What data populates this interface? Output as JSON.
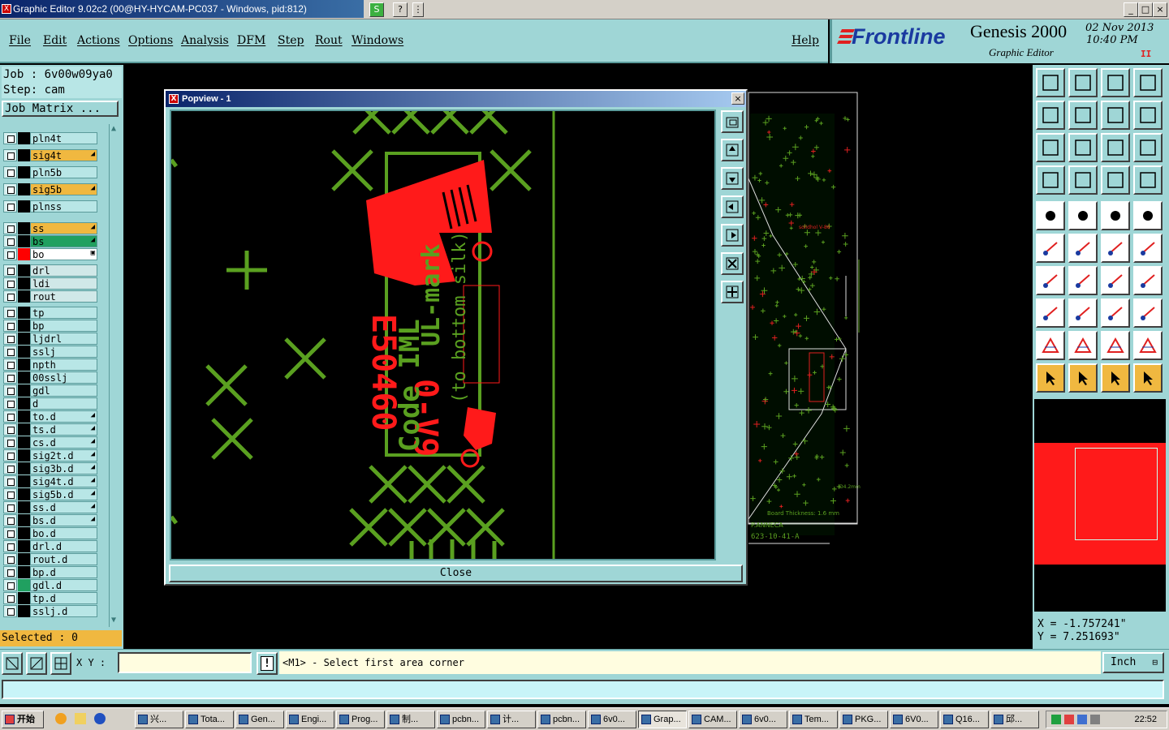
{
  "window": {
    "title": "Graphic Editor 9.02c2 (00@HY-HYCAM-PC037 - Windows, pid:812)",
    "min_btn": "_",
    "max_btn": "□",
    "close_btn": "×",
    "tool_s": "S",
    "tool_help": "?",
    "tool_menu": "⋮"
  },
  "menu": {
    "file": "File",
    "edit": "Edit",
    "actions": "Actions",
    "options": "Options",
    "analysis": "Analysis",
    "dfm": "DFM",
    "step": "Step",
    "rout": "Rout",
    "windows": "Windows",
    "help": "Help"
  },
  "brand": {
    "logo": "Frontline",
    "product": "Genesis 2000",
    "subtitle": "Graphic Editor",
    "date": "02 Nov 2013",
    "time": "10:40 PM",
    "flag": "II"
  },
  "job": {
    "job_label": "Job : 6v00w09ya0",
    "step_label": "Step: cam",
    "matrix_button": "Job Matrix ..."
  },
  "layers": [
    {
      "name": "pln4t",
      "color": "#000000",
      "style": "",
      "mark": ""
    },
    {
      "name": "sig4t",
      "color": "#000000",
      "style": "hl",
      "mark": "◢"
    },
    {
      "name": "pln5b",
      "color": "#000000",
      "style": "",
      "mark": ""
    },
    {
      "name": "sig5b",
      "color": "#000000",
      "style": "hl",
      "mark": "◢"
    },
    {
      "name": "plnss",
      "color": "#000000",
      "style": "",
      "mark": ""
    },
    {
      "name": "ss",
      "color": "#000000",
      "style": "hl",
      "mark": "◢"
    },
    {
      "name": "bs",
      "color": "#000000",
      "style": "grn",
      "mark": "◢"
    },
    {
      "name": "bo",
      "color": "#ff0000",
      "style": "wht",
      "mark": "▣"
    },
    {
      "name": "drl",
      "color": "#000000",
      "style": "gray",
      "mark": ""
    },
    {
      "name": "ldi",
      "color": "#000000",
      "style": "gray",
      "mark": ""
    },
    {
      "name": "rout",
      "color": "#000000",
      "style": "gray",
      "mark": ""
    },
    {
      "name": "tp",
      "color": "#000000",
      "style": "",
      "mark": ""
    },
    {
      "name": "bp",
      "color": "#000000",
      "style": "",
      "mark": ""
    },
    {
      "name": "ljdrl",
      "color": "#000000",
      "style": "",
      "mark": ""
    },
    {
      "name": "sslj",
      "color": "#000000",
      "style": "",
      "mark": ""
    },
    {
      "name": "npth",
      "color": "#000000",
      "style": "",
      "mark": ""
    },
    {
      "name": "00sslj",
      "color": "#000000",
      "style": "",
      "mark": ""
    },
    {
      "name": "gdl",
      "color": "#000000",
      "style": "",
      "mark": ""
    },
    {
      "name": "d",
      "color": "#000000",
      "style": "",
      "mark": ""
    },
    {
      "name": "to.d",
      "color": "#000000",
      "style": "",
      "mark": "◢"
    },
    {
      "name": "ts.d",
      "color": "#000000",
      "style": "",
      "mark": "◢"
    },
    {
      "name": "cs.d",
      "color": "#000000",
      "style": "",
      "mark": "◢"
    },
    {
      "name": "sig2t.d",
      "color": "#000000",
      "style": "",
      "mark": "◢"
    },
    {
      "name": "sig3b.d",
      "color": "#000000",
      "style": "",
      "mark": "◢"
    },
    {
      "name": "sig4t.d",
      "color": "#000000",
      "style": "",
      "mark": "◢"
    },
    {
      "name": "sig5b.d",
      "color": "#000000",
      "style": "",
      "mark": "◢"
    },
    {
      "name": "ss.d",
      "color": "#000000",
      "style": "",
      "mark": "◢"
    },
    {
      "name": "bs.d",
      "color": "#000000",
      "style": "",
      "mark": "◢"
    },
    {
      "name": "bo.d",
      "color": "#000000",
      "style": "",
      "mark": ""
    },
    {
      "name": "drl.d",
      "color": "#000000",
      "style": "",
      "mark": ""
    },
    {
      "name": "rout.d",
      "color": "#000000",
      "style": "",
      "mark": ""
    },
    {
      "name": "bp.d",
      "color": "#000000",
      "style": "",
      "mark": ""
    },
    {
      "name": "gdl.d",
      "color": "#20a060",
      "style": "",
      "mark": ""
    },
    {
      "name": "tp.d",
      "color": "#000000",
      "style": "",
      "mark": ""
    },
    {
      "name": "sslj.d",
      "color": "#000000",
      "style": "",
      "mark": ""
    }
  ],
  "selected": "Selected : 0",
  "popview": {
    "title": "Popview - 1",
    "close_label": "Close",
    "close_x": "×"
  },
  "coords": {
    "x": "X = -1.757241\"",
    "y": "Y = 7.251693\""
  },
  "status": {
    "xy_label": "X Y :",
    "xy_value": "",
    "prompt": "<M1> - Select first area corner",
    "unit": "Inch",
    "alert_icon": "!"
  },
  "board": {
    "mark1": "solidhol V-86",
    "mark2": "Board Thickness: 1.6 mm",
    "mark3": "P.ANNECA",
    "mark4": "623-10-41-A",
    "mark5": "D4.2mm"
  },
  "artwork": {
    "line1": "UL-mark",
    "line2": "(to bottom silk)",
    "line3": "E50460",
    "line4": "0-V9",
    "line5": "Code IML",
    "reg": "®"
  },
  "taskbar": {
    "start": "开始",
    "items": [
      "兴...",
      "Tota...",
      "Gen...",
      "Engi...",
      "Prog...",
      "制...",
      "pcbn...",
      "计...",
      "pcbn...",
      "6v0...",
      "Grap...",
      "CAM...",
      "6v0...",
      "Tem...",
      "PKG...",
      "6V0...",
      "Q16...",
      "邱..."
    ],
    "clock": "22:52"
  },
  "colors": {
    "panel": "#9fd6d6",
    "accent_orange": "#f0b840",
    "green_feature": "#5aa020",
    "red_feature": "#ff1a1a"
  }
}
